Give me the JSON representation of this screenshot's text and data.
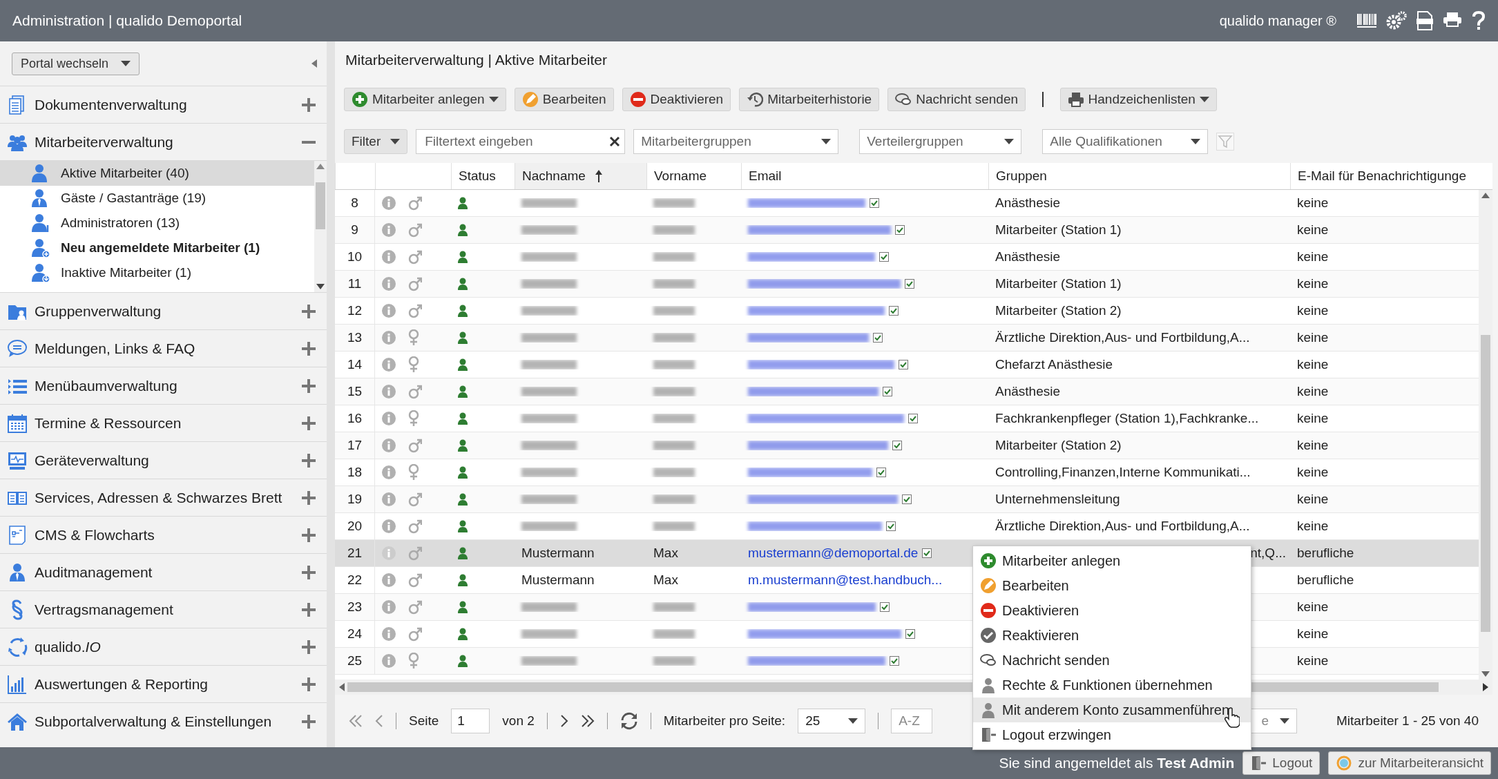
{
  "header": {
    "title": "Administration | qualido Demoportal",
    "product": "qualido manager ®"
  },
  "sidebar": {
    "portal_switch": "Portal wechseln",
    "sections": [
      {
        "label": "Dokumentenverwaltung",
        "expanded": false
      },
      {
        "label": "Mitarbeiterverwaltung",
        "expanded": true,
        "children": [
          {
            "label": "Aktive Mitarbeiter (40)",
            "selected": true,
            "bold": false
          },
          {
            "label": "Gäste / Gastanträge (19)",
            "selected": false,
            "bold": false
          },
          {
            "label": "Administratoren (13)",
            "selected": false,
            "bold": false
          },
          {
            "label": "Neu angemeldete Mitarbeiter (1)",
            "selected": false,
            "bold": true
          },
          {
            "label": "Inaktive Mitarbeiter (1)",
            "selected": false,
            "bold": false
          }
        ]
      },
      {
        "label": "Gruppenverwaltung",
        "expanded": false
      },
      {
        "label": "Meldungen, Links & FAQ",
        "expanded": false
      },
      {
        "label": "Menübaumverwaltung",
        "expanded": false
      },
      {
        "label": "Termine & Ressourcen",
        "expanded": false
      },
      {
        "label": "Geräteverwaltung",
        "expanded": false
      },
      {
        "label": "Services, Adressen & Schwarzes Brett",
        "expanded": false
      },
      {
        "label": "CMS & Flowcharts",
        "expanded": false
      },
      {
        "label": "Auditmanagement",
        "expanded": false
      },
      {
        "label": "Vertragsmanagement",
        "expanded": false
      },
      {
        "label": "qualido.*IO*",
        "expanded": false
      },
      {
        "label": "Auswertungen & Reporting",
        "expanded": false
      },
      {
        "label": "Subportalverwaltung & Einstellungen",
        "expanded": false
      }
    ]
  },
  "main": {
    "breadcrumb": "Mitarbeiterverwaltung | Aktive Mitarbeiter",
    "toolbar": [
      {
        "kind": "add",
        "label": "Mitarbeiter anlegen",
        "has_menu": true
      },
      {
        "kind": "edit",
        "label": "Bearbeiten",
        "has_menu": false
      },
      {
        "kind": "deactivate",
        "label": "Deaktivieren",
        "has_menu": false
      },
      {
        "kind": "history",
        "label": "Mitarbeiterhistorie",
        "has_menu": false
      },
      {
        "kind": "message",
        "label": "Nachricht senden",
        "has_menu": false
      },
      {
        "kind": "print",
        "label": "Handzeichenlisten",
        "has_menu": true
      }
    ],
    "filter": {
      "button": "Filter",
      "search_placeholder": "Filtertext eingeben",
      "dropdowns": [
        "Mitarbeitergruppen",
        "Verteilergruppen",
        "Alle Qualifikationen"
      ]
    },
    "table": {
      "columns": [
        {
          "label": "Status",
          "sorted": false
        },
        {
          "label": "Nachname",
          "sorted": true
        },
        {
          "label": "Vorname",
          "sorted": false
        },
        {
          "label": "Email",
          "sorted": false
        },
        {
          "label": "Gruppen",
          "sorted": false
        },
        {
          "label": "E-Mail für Benachrichtigunge",
          "sorted": false
        }
      ],
      "rows": [
        {
          "nr": "8",
          "female": false,
          "active": true,
          "redacted": true,
          "gruppen": "Anästhesie",
          "benachrichtigung": "keine",
          "selected": false
        },
        {
          "nr": "9",
          "female": false,
          "active": true,
          "redacted": true,
          "gruppen": "Mitarbeiter (Station 1)",
          "benachrichtigung": "keine",
          "selected": false
        },
        {
          "nr": "10",
          "female": false,
          "active": true,
          "redacted": true,
          "gruppen": "Anästhesie",
          "benachrichtigung": "keine",
          "selected": false
        },
        {
          "nr": "11",
          "female": false,
          "active": true,
          "redacted": true,
          "gruppen": "Mitarbeiter (Station 1)",
          "benachrichtigung": "keine",
          "selected": false
        },
        {
          "nr": "12",
          "female": false,
          "active": true,
          "redacted": true,
          "gruppen": "Mitarbeiter (Station 2)",
          "benachrichtigung": "keine",
          "selected": false
        },
        {
          "nr": "13",
          "female": true,
          "active": true,
          "redacted": true,
          "gruppen": "Ärztliche Direktion,Aus- und Fortbildung,A...",
          "benachrichtigung": "keine",
          "selected": false
        },
        {
          "nr": "14",
          "female": true,
          "active": true,
          "redacted": true,
          "gruppen": "Chefarzt Anästhesie",
          "benachrichtigung": "keine",
          "selected": false
        },
        {
          "nr": "15",
          "female": false,
          "active": true,
          "redacted": true,
          "gruppen": "Anästhesie",
          "benachrichtigung": "keine",
          "selected": false
        },
        {
          "nr": "16",
          "female": true,
          "active": true,
          "redacted": true,
          "gruppen": "Fachkrankenpfleger (Station 1),Fachkranke...",
          "benachrichtigung": "keine",
          "selected": false
        },
        {
          "nr": "17",
          "female": false,
          "active": true,
          "redacted": true,
          "gruppen": "Mitarbeiter (Station 2)",
          "benachrichtigung": "keine",
          "selected": false
        },
        {
          "nr": "18",
          "female": true,
          "active": true,
          "redacted": true,
          "gruppen": "Controlling,Finanzen,Interne Kommunikati...",
          "benachrichtigung": "keine",
          "selected": false
        },
        {
          "nr": "19",
          "female": false,
          "active": true,
          "redacted": true,
          "gruppen": "Unternehmensleitung",
          "benachrichtigung": "keine",
          "selected": false
        },
        {
          "nr": "20",
          "female": false,
          "active": true,
          "redacted": true,
          "gruppen": "Ärztliche Direktion,Aus- und Fortbildung,A...",
          "benachrichtigung": "keine",
          "selected": false
        },
        {
          "nr": "21",
          "female": false,
          "active": true,
          "nachname": "Mustermann",
          "vorname": "Max",
          "email": "mustermann@demoportal.de",
          "email_verified": true,
          "gruppen": "nt,Q...",
          "gruppen_covered": true,
          "benachrichtigung": "berufliche",
          "selected": true
        },
        {
          "nr": "22",
          "female": false,
          "active": true,
          "nachname": "Mustermann",
          "vorname": "Max",
          "email": "m.mustermann@test.handbuch...",
          "benachrichtigung": "berufliche",
          "selected": false
        },
        {
          "nr": "23",
          "female": false,
          "active": true,
          "redacted": true,
          "benachrichtigung": "keine",
          "selected": false
        },
        {
          "nr": "24",
          "female": false,
          "active": true,
          "redacted": true,
          "benachrichtigung": "keine",
          "selected": false
        },
        {
          "nr": "25",
          "female": true,
          "active": true,
          "redacted": true,
          "benachrichtigung": "keine",
          "selected": false
        }
      ]
    },
    "pagination": {
      "page_label": "Seite",
      "page": "1",
      "of": "von 2",
      "per_page_label": "Mitarbeiter pro Seite:",
      "per_page": "25",
      "sort": "A-Z",
      "sort_order": "e",
      "summary": "Mitarbeiter 1 - 25 von 40"
    }
  },
  "context_menu": [
    {
      "kind": "add",
      "label": "Mitarbeiter anlegen",
      "selected": false
    },
    {
      "kind": "edit",
      "label": "Bearbeiten",
      "selected": false
    },
    {
      "kind": "deactivate",
      "label": "Deaktivieren",
      "selected": false
    },
    {
      "kind": "reactivate",
      "label": "Reaktivieren",
      "selected": false
    },
    {
      "kind": "message",
      "label": "Nachricht senden",
      "selected": false
    },
    {
      "kind": "rights",
      "label": "Rechte & Funktionen übernehmen",
      "selected": false
    },
    {
      "kind": "merge",
      "label": "Mit anderem Konto zusammenführen",
      "selected": true
    },
    {
      "kind": "logout",
      "label": "Logout erzwingen",
      "selected": false
    }
  ],
  "footer": {
    "login_text": "Sie sind angemeldet als **Test Admin**",
    "buttons": [
      {
        "kind": "logout",
        "label": "Logout"
      },
      {
        "kind": "view",
        "label": "zur Mitarbeiteransicht"
      }
    ]
  }
}
